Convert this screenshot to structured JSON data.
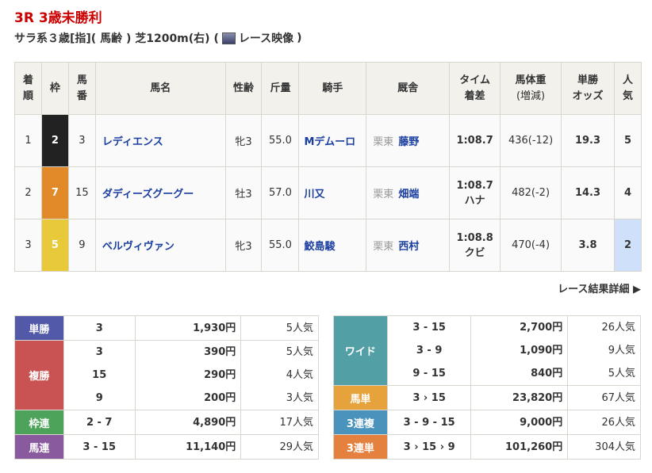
{
  "race": {
    "title": "3R 3歳未勝利",
    "conditions": "サラ系３歳[指](  馬齢  )  芝1200m(右)  (",
    "video_label": "レース映像",
    "close_paren": ")"
  },
  "headers": {
    "rank": "着順",
    "waku": "枠",
    "num": "馬番",
    "name": "馬名",
    "sexage": "性齢",
    "weight": "斤量",
    "jockey": "騎手",
    "stable": "厩舎",
    "time1": "タイム",
    "time2": "着差",
    "bw1": "馬体重",
    "bw2": "(増減)",
    "odds1": "単勝",
    "odds2": "オッズ",
    "pop": "人気"
  },
  "rows": [
    {
      "rank": "1",
      "waku": "2",
      "waku_color": "#222222",
      "num": "3",
      "name": "レディエンス",
      "sexage": "牝3",
      "weight": "55.0",
      "jockey": "Mデムーロ",
      "area": "栗東",
      "trainer": "藤野",
      "time": "1:08.7",
      "margin": "",
      "bw": "436(-12)",
      "odds": "19.3",
      "pop": "5"
    },
    {
      "rank": "2",
      "waku": "7",
      "waku_color": "#e2892a",
      "num": "15",
      "name": "ダディーズグーグー",
      "sexage": "牡3",
      "weight": "57.0",
      "jockey": "川又",
      "area": "栗東",
      "trainer": "畑端",
      "time": "1:08.7",
      "margin": "ハナ",
      "bw": "482(-2)",
      "odds": "14.3",
      "pop": "4"
    },
    {
      "rank": "3",
      "waku": "5",
      "waku_color": "#e8c93a",
      "num": "9",
      "name": "ベルヴィヴァン",
      "sexage": "牝3",
      "weight": "55.0",
      "jockey": "鮫島駿",
      "area": "栗東",
      "trainer": "西村",
      "time": "1:08.8",
      "margin": "クビ",
      "bw": "470(-4)",
      "odds": "3.8",
      "pop": "2"
    }
  ],
  "more_link": "レース結果詳細 ▶",
  "payouts_left": [
    {
      "label": "単勝",
      "color": "#5259a8",
      "lines": [
        {
          "combo": "3",
          "amount": "1,930円",
          "pop": "5人気"
        }
      ]
    },
    {
      "label": "複勝",
      "color": "#c95253",
      "lines": [
        {
          "combo": "3",
          "amount": "390円",
          "pop": "5人気"
        },
        {
          "combo": "15",
          "amount": "290円",
          "pop": "4人気"
        },
        {
          "combo": "9",
          "amount": "200円",
          "pop": "3人気"
        }
      ]
    },
    {
      "label": "枠連",
      "color": "#4ea35a",
      "lines": [
        {
          "combo": "2 - 7",
          "amount": "4,890円",
          "pop": "17人気"
        }
      ]
    },
    {
      "label": "馬連",
      "color": "#8a5a9e",
      "lines": [
        {
          "combo": "3 - 15",
          "amount": "11,140円",
          "pop": "29人気"
        }
      ]
    }
  ],
  "payouts_right": [
    {
      "label": "ワイド",
      "color": "#52a0a6",
      "lines": [
        {
          "combo": "3 - 15",
          "amount": "2,700円",
          "pop": "26人気"
        },
        {
          "combo": "3 - 9",
          "amount": "1,090円",
          "pop": "9人気"
        },
        {
          "combo": "9 - 15",
          "amount": "840円",
          "pop": "5人気"
        }
      ]
    },
    {
      "label": "馬単",
      "color": "#e6a33c",
      "lines": [
        {
          "combo": "3 › 15",
          "amount": "23,820円",
          "pop": "67人気"
        }
      ]
    },
    {
      "label": "3連複",
      "color": "#4a93bd",
      "lines": [
        {
          "combo": "3 - 9 - 15",
          "amount": "9,000円",
          "pop": "26人気"
        }
      ]
    },
    {
      "label": "3連単",
      "color": "#e5813f",
      "lines": [
        {
          "combo": "3 › 15 › 9",
          "amount": "101,260円",
          "pop": "304人気"
        }
      ]
    }
  ]
}
